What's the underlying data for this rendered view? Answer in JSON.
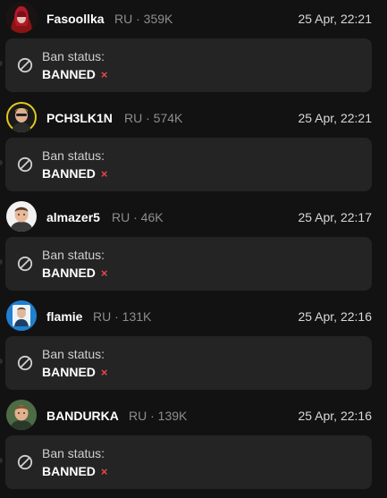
{
  "colors": {
    "background": "#121212",
    "card": "#242424",
    "username": "#ffffff",
    "meta": "#8e8e93",
    "date": "#d9d9d9",
    "ban_icon": "#d0d0d0",
    "ban_x": "#e5484d"
  },
  "icons": {
    "ban": "prohibited-circle-icon",
    "status_mark": "cross-icon"
  },
  "entries": [
    {
      "username": "Fasoollka",
      "meta": "RU · 359K",
      "date": "25 Apr, 22:21",
      "avatar": "avatar-fasoollka",
      "ban_label": "Ban status:",
      "ban_value": "BANNED",
      "ban_mark": "×"
    },
    {
      "username": "PCH3LK1N",
      "meta": "RU · 574K",
      "date": "25 Apr, 22:21",
      "avatar": "avatar-pch3lk1n",
      "ban_label": "Ban status:",
      "ban_value": "BANNED",
      "ban_mark": "×"
    },
    {
      "username": "almazer5",
      "meta": "RU · 46K",
      "date": "25 Apr, 22:17",
      "avatar": "avatar-almazer5",
      "ban_label": "Ban status:",
      "ban_value": "BANNED",
      "ban_mark": "×"
    },
    {
      "username": "flamie",
      "meta": "RU · 131K",
      "date": "25 Apr, 22:16",
      "avatar": "avatar-flamie",
      "ban_label": "Ban status:",
      "ban_value": "BANNED",
      "ban_mark": "×"
    },
    {
      "username": "BANDURKA",
      "meta": "RU · 139K",
      "date": "25 Apr, 22:16",
      "avatar": "avatar-bandurka",
      "ban_label": "Ban status:",
      "ban_value": "BANNED",
      "ban_mark": "×"
    }
  ]
}
